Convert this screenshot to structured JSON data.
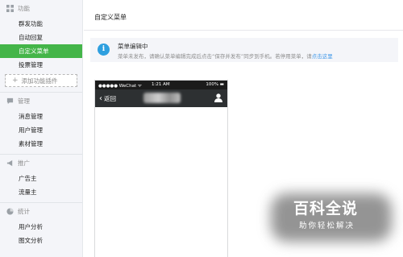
{
  "sidebar": {
    "groups": [
      {
        "title": "功能",
        "icon": "grid-icon",
        "items": [
          {
            "label": "群发功能",
            "active": false
          },
          {
            "label": "自动回复",
            "active": false
          },
          {
            "label": "自定义菜单",
            "active": true
          },
          {
            "label": "投票管理",
            "active": false
          }
        ],
        "add_plugin": "添加功能插件"
      },
      {
        "title": "管理",
        "icon": "chat-icon",
        "items": [
          {
            "label": "消息管理"
          },
          {
            "label": "用户管理"
          },
          {
            "label": "素材管理"
          }
        ]
      },
      {
        "title": "推广",
        "icon": "megaphone-icon",
        "items": [
          {
            "label": "广告主"
          },
          {
            "label": "流量主"
          }
        ]
      },
      {
        "title": "统计",
        "icon": "pie-chart-icon",
        "items": [
          {
            "label": "用户分析"
          },
          {
            "label": "图文分析"
          }
        ]
      }
    ]
  },
  "main": {
    "title": "自定义菜单",
    "notice": {
      "title": "菜单编辑中",
      "desc": "菜单未发布，请确认菜单编辑完成后点击“保存并发布”同步到手机。若停用菜单，请",
      "link": "点击这里"
    },
    "phone": {
      "status_left": "●●●●● WeChat ᯤ",
      "status_time": "1:21 AM",
      "status_right": "100% ▬",
      "back_label": "返回"
    }
  },
  "watermark": {
    "title": "百科全说",
    "subtitle": "助你轻松解决"
  },
  "colors": {
    "accent": "#44b549",
    "info": "#2e9fdf",
    "link": "#459ae9"
  }
}
